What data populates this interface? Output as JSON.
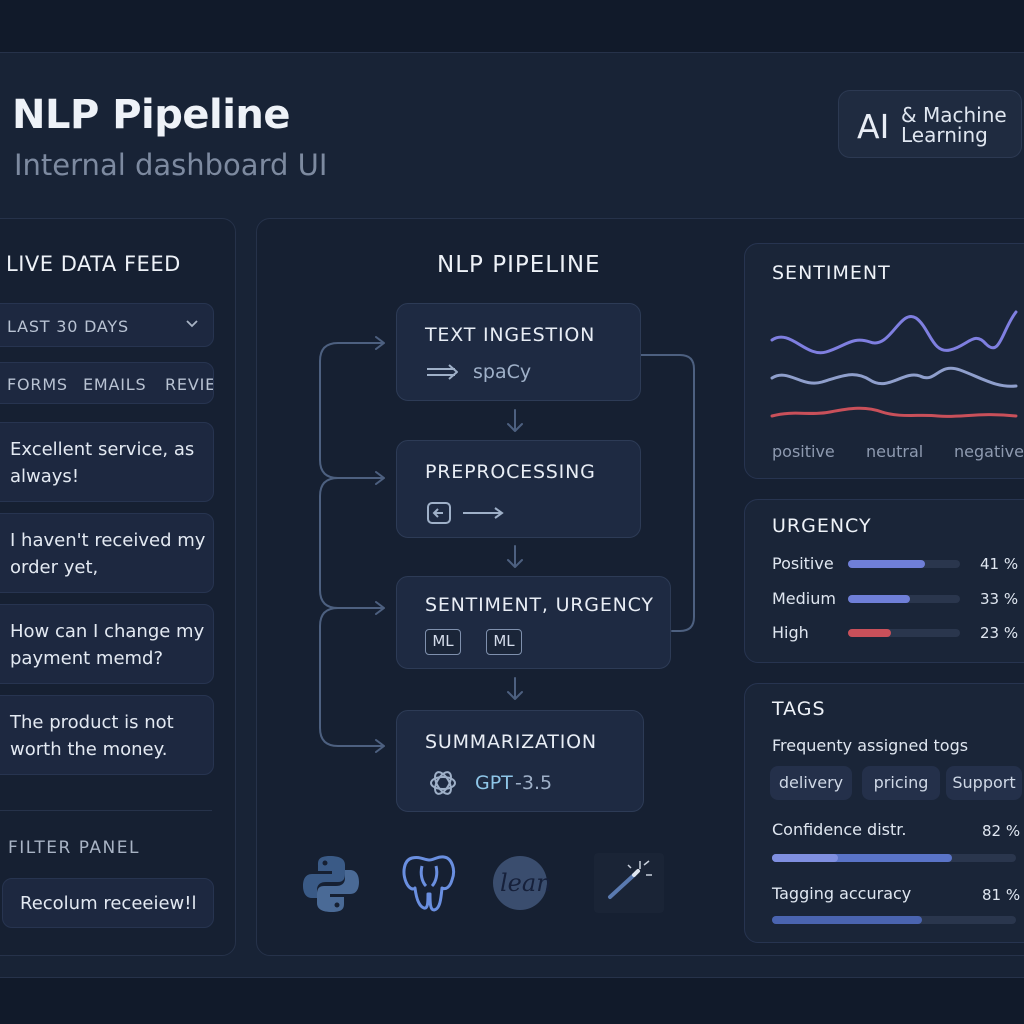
{
  "header": {
    "title": "NLP Pipeline",
    "subtitle": "Internal dashboard UI",
    "badge_main": "AI",
    "badge_line1": "& Machine",
    "badge_line2": "Learning"
  },
  "feed": {
    "title": "LIVE DATA FEED",
    "range": "LAST 30 DAYS",
    "tabs": [
      "FORMS",
      "EMAILS",
      "REVIE"
    ],
    "messages": [
      "Excellent service, as always!",
      "I haven't received my order yet,",
      "How can I change my payment memd?",
      "The product is not worth the money."
    ],
    "filter_title": "FILTER PANEL",
    "filter_button": "Recolum receeiew!l"
  },
  "pipeline": {
    "title": "NLP PIPELINE",
    "nodes": [
      {
        "name": "TEXT INGESTION",
        "sub": "spaCy"
      },
      {
        "name": "PREPROCESSING",
        "sub": ""
      },
      {
        "name": "SENTIMENT, URGENCY",
        "chips": [
          "ML",
          "ML"
        ]
      },
      {
        "name": "SUMMARIZATION",
        "sub_a": "GPT",
        "sub_b": "-3.5"
      }
    ],
    "logos": [
      "python-logo",
      "postgresql-logo",
      "lean-logo",
      "magic-wand-logo"
    ],
    "lean_text": "lean"
  },
  "sentiment": {
    "title": "SENTIMENT",
    "labels": [
      "positive",
      "neutral",
      "negative"
    ],
    "colors": {
      "positive": "#7f7fe0",
      "neutral": "#8f9fcc",
      "negative": "#c9505a"
    }
  },
  "urgency": {
    "title": "URGENCY",
    "rows": [
      {
        "label": "Positive",
        "value": 41,
        "pct": "41 %",
        "color": "#6f7fd8"
      },
      {
        "label": "Medium",
        "value": 33,
        "pct": "33 %",
        "color": "#6f7fd8"
      },
      {
        "label": "High",
        "value": 23,
        "pct": "23 %",
        "color": "#c9505a"
      }
    ]
  },
  "tags": {
    "title": "TAGS",
    "subtitle": "Frequenty assigned togs",
    "items": [
      "delivery",
      "pricing",
      "Support"
    ],
    "confidence_label": "Confidence distr.",
    "confidence_pct": "82 %",
    "confidence_value": 82,
    "accuracy_label": "Tagging accuracy",
    "accuracy_pct": "81 %",
    "accuracy_value": 81
  }
}
